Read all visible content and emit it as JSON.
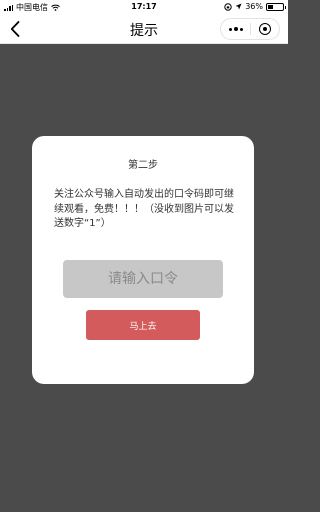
{
  "status_bar": {
    "carrier": "中国电信",
    "time": "17:17",
    "battery_percent": "36%",
    "battery_level": 0.36
  },
  "nav": {
    "title": "提示"
  },
  "dialog": {
    "step_title": "第二步",
    "message": "关注公众号输入自动发出的口令码即可继续观看，免费！！！（没收到图片可以发送数字“1”）",
    "input_placeholder": "请输入口令",
    "input_value": "",
    "button_label": "马上去"
  },
  "colors": {
    "overlay": "#4b4b4b",
    "button": "#d45b5b",
    "input_bg": "#c7c7c7"
  }
}
